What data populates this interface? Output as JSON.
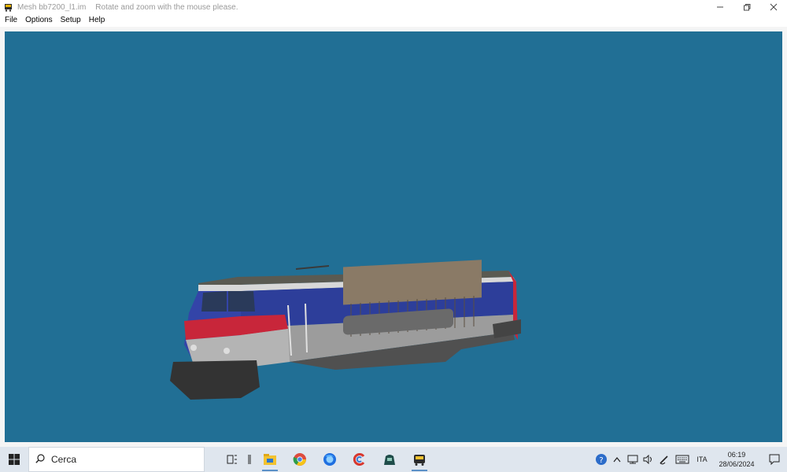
{
  "window": {
    "title": "Mesh bb7200_l1.im",
    "hint": "Rotate and zoom with the mouse please.",
    "controls": [
      "minimize-icon",
      "restore-icon",
      "close-icon"
    ]
  },
  "menu": {
    "items": [
      "File",
      "Options",
      "Setup",
      "Help"
    ]
  },
  "viewport": {
    "background": "#216f95",
    "model": "locomotive-3d-model"
  },
  "taskbar": {
    "search_placeholder": "Cerca",
    "apps": [
      "task-view-icon",
      "divider",
      "file-explorer-icon",
      "chrome-icon",
      "firefox-icon",
      "ccleaner-icon",
      "train-sim-icon",
      "locomotive-app-icon"
    ],
    "tray": {
      "lang": "ITA",
      "time": "06:19",
      "date": "28/06/2024"
    }
  }
}
